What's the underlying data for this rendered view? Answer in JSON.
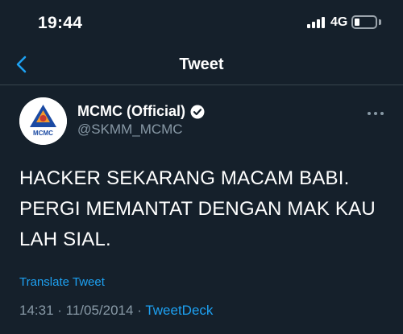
{
  "status_bar": {
    "time": "19:44",
    "network": "4G",
    "battery_level_percent": 25
  },
  "header": {
    "title": "Tweet",
    "back_icon": "chevron-left-icon"
  },
  "tweet": {
    "author": {
      "display_name": "MCMC (Official)",
      "handle": "@SKMM_MCMC",
      "verified": true,
      "avatar_label": "MCMC"
    },
    "text_lines": [
      "HACKER SEKARANG MACAM BABI.",
      "PERGI MEMANTAT DENGAN MAK KAU",
      "LAH SIAL."
    ],
    "translate_label": "Translate Tweet",
    "timestamp": "14:31 · 11/05/2014",
    "separator": "·",
    "source": "TweetDeck"
  },
  "colors": {
    "background": "#15202b",
    "accent": "#1da1f2",
    "secondary_text": "#8899a6",
    "divider": "#38444d"
  }
}
